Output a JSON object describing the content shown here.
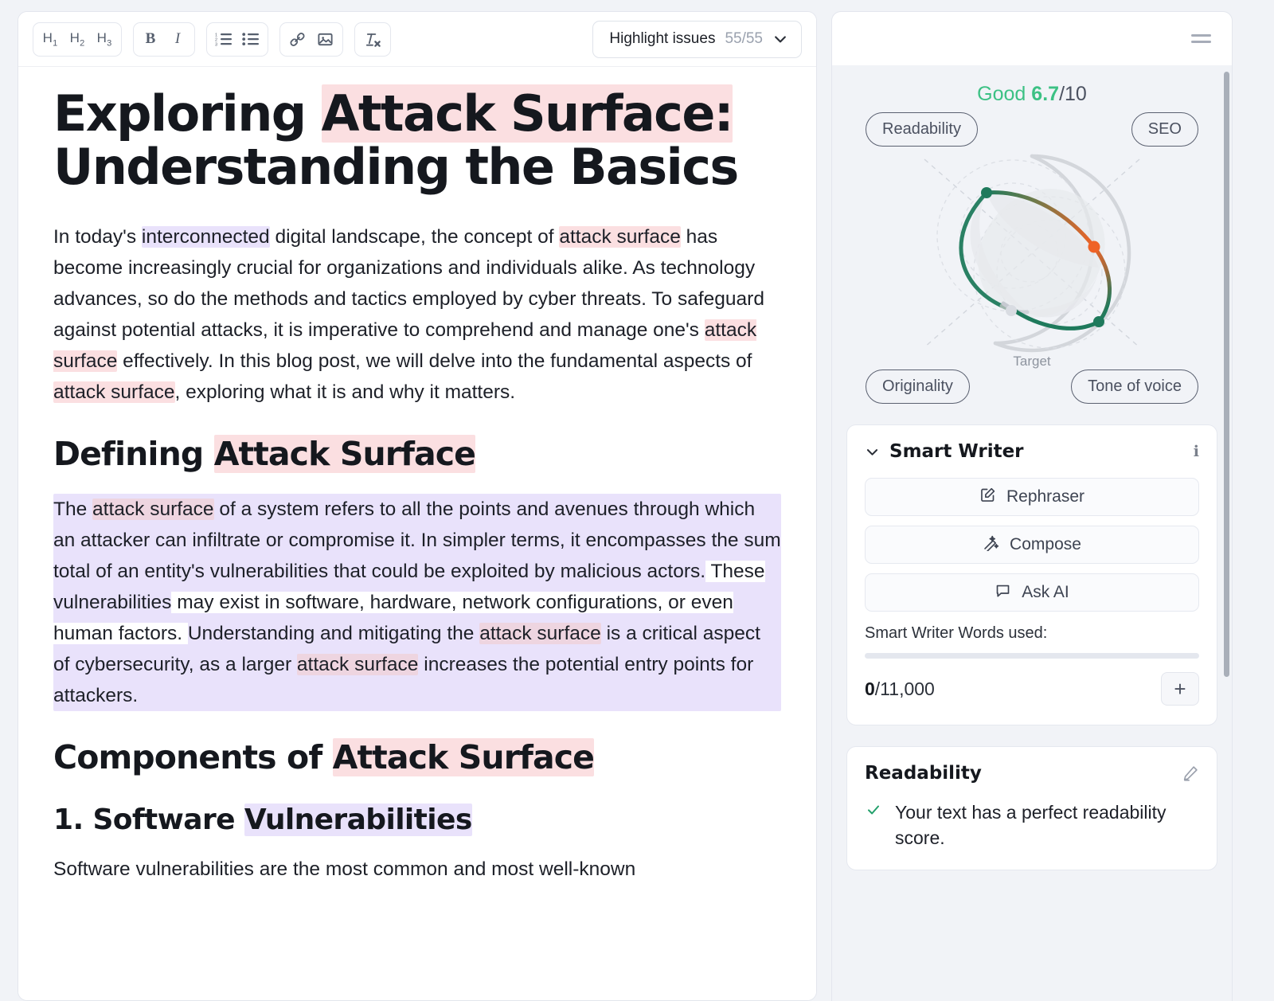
{
  "toolbar": {
    "heading_buttons": [
      {
        "name": "h1",
        "label": "H",
        "sub": "1"
      },
      {
        "name": "h2",
        "label": "H",
        "sub": "2"
      },
      {
        "name": "h3",
        "label": "H",
        "sub": "3"
      }
    ],
    "bold_label": "B",
    "italic_label": "I",
    "icons": [
      "ordered-list-icon",
      "bullet-list-icon",
      "link-icon",
      "image-icon",
      "clear-formatting-icon"
    ],
    "highlight_issues": {
      "label": "Highlight issues",
      "count": "55/55",
      "chevron": "chevron-down-icon"
    }
  },
  "document": {
    "title_part1": "Exploring ",
    "title_highlight": "Attack Surface:",
    "title_part2": " Understanding the Basics",
    "p1": {
      "s1": "In today's ",
      "hl_purple1": "interconnected",
      "s2": " digital landscape, the concept of ",
      "hl_pink1": "attack surface",
      "s3": " has become increasingly crucial for organizations and individuals alike. As technology advances, so do the methods and tactics employed by cyber threats. To safeguard against potential attacks, it is imperative to comprehend and manage one's ",
      "hl_pink2": "attack surface",
      "s4": " effectively. In this blog post, we will delve into the fundamental aspects of ",
      "hl_pink3": "attack surface",
      "s5": ", exploring what it is and why it matters."
    },
    "h2_defining_plain": "Defining ",
    "h2_defining_hl": "Attack Surface",
    "p2": {
      "s0": "The ",
      "hl_pink_a": "attack surface",
      "s1": " of a system refers to all the points and avenues through which an attacker can infiltrate or compromise it. In simpler terms, it encompasses the sum total of an entity's vulnerabilities that could be exploited by malicious actors.",
      "s2": " These ",
      "hl_purple_b": "vulnerabilities",
      "s3": " may exist in software, hardware, network configurations, or even human factors. ",
      "hl_purple_c_pre": "Understanding and mitigating the ",
      "hl_pink_b": "attack surface",
      "hl_purple_c_post": " is a critical aspect of cybersecurity, as a larger ",
      "hl_pink_c": "attack surface",
      "hl_purple_c_end": " increases the potential entry points for attackers."
    },
    "h2_components_plain": "Components of ",
    "h2_components_hl": "Attack Surface",
    "h3_software_plain": "1. Software ",
    "h3_software_hl": "Vulnerabilities",
    "cut_text": "Software vulnerabilities are the most common and most well-known"
  },
  "sidebar": {
    "menu_icon": "hamburger-menu-icon",
    "score": {
      "quality_label": "Good",
      "value": "6.7",
      "denominator": "/10"
    },
    "metrics": [
      {
        "name": "readability",
        "label": "Readability"
      },
      {
        "name": "seo",
        "label": "SEO"
      },
      {
        "name": "originality",
        "label": "Originality"
      },
      {
        "name": "tone-of-voice",
        "label": "Tone of voice"
      }
    ],
    "target_label": "Target",
    "smart_writer": {
      "title": "Smart Writer",
      "collapse_icon": "chevron-down-icon",
      "info_icon": "info-icon",
      "actions": [
        {
          "name": "rephraser",
          "label": "Rephraser",
          "icon": "pencil-square-icon"
        },
        {
          "name": "compose",
          "label": "Compose",
          "icon": "magic-wand-icon"
        },
        {
          "name": "ask-ai",
          "label": "Ask AI",
          "icon": "chat-bubble-icon"
        }
      ],
      "usage_label": "Smart Writer Words used:",
      "used": "0",
      "limit": "/11,000",
      "add_label": "+",
      "progress_percent": 0
    },
    "readability_card": {
      "title": "Readability",
      "edit_icon": "pencil-icon",
      "items": [
        {
          "status": "ok",
          "text": "Your text has a perfect readability score."
        }
      ]
    }
  },
  "chart_data": {
    "type": "radar",
    "title": "Content quality radar",
    "axes": [
      "Readability",
      "SEO",
      "Tone of voice",
      "Originality"
    ],
    "target_ring_label": "Target",
    "points": [
      {
        "axis": "Readability",
        "value": 9.0,
        "color": "#1f7a5c",
        "status": "good"
      },
      {
        "axis": "SEO",
        "value": 6.0,
        "color": "#ef6327",
        "status": "warning"
      },
      {
        "axis": "Tone of voice",
        "value": 9.0,
        "color": "#1f7a5c",
        "status": "good"
      },
      {
        "axis": "Originality",
        "value": 0.5,
        "color": "#d9dce2",
        "status": "neutral"
      }
    ],
    "overall_score": 6.7,
    "scale": [
      0,
      10
    ],
    "grid": "dashed-concentric-circles",
    "legend": "none"
  },
  "colors": {
    "accent_good": "#3cc184",
    "accent_warning": "#ef6327",
    "accent_dark_green": "#1f7a5c",
    "highlight_pink": "#fbdfe1",
    "highlight_purple": "#e9e2fb",
    "page_bg": "#f1f3f7"
  }
}
